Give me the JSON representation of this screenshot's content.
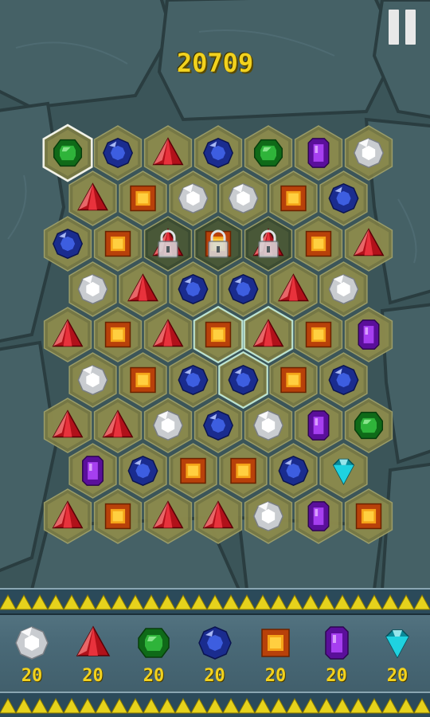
{
  "score": "20709",
  "pause_button": {
    "icon": "pause-icon"
  },
  "board": {
    "rows": [
      [
        "green",
        "blue",
        "red",
        "blue",
        "green",
        "purple",
        "white"
      ],
      [
        "red",
        "orange",
        "white",
        "white",
        "orange",
        "blue"
      ],
      [
        "blue",
        "orange",
        "locked-red",
        "locked-orange",
        "locked-red",
        "orange",
        "red"
      ],
      [
        "white",
        "red",
        "blue",
        "blue",
        "red",
        "white"
      ],
      [
        "red",
        "orange",
        "red",
        "orange",
        "red",
        "orange",
        "purple"
      ],
      [
        "white",
        "orange",
        "blue",
        "blue",
        "orange",
        "blue"
      ],
      [
        "red",
        "red",
        "white",
        "blue",
        "white",
        "purple",
        "green"
      ],
      [
        "purple",
        "blue",
        "orange",
        "orange",
        "blue",
        "cyan"
      ],
      [
        "red",
        "orange",
        "red",
        "red",
        "white",
        "purple",
        "orange"
      ]
    ],
    "selected_cell": {
      "row": 0,
      "col": 0
    },
    "highlighted_cells": [
      [
        4,
        3
      ],
      [
        4,
        4
      ],
      [
        5,
        3
      ]
    ]
  },
  "goals": [
    {
      "gem": "white",
      "count": "20"
    },
    {
      "gem": "red",
      "count": "20"
    },
    {
      "gem": "green",
      "count": "20"
    },
    {
      "gem": "blue",
      "count": "20"
    },
    {
      "gem": "orange",
      "count": "20"
    },
    {
      "gem": "purple",
      "count": "20"
    },
    {
      "gem": "cyan",
      "count": "20"
    }
  ]
}
